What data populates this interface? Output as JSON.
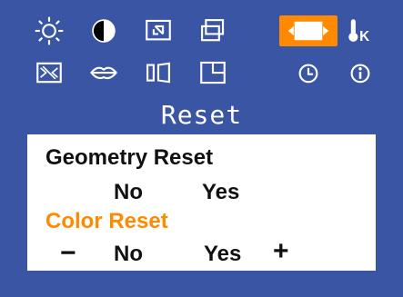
{
  "menu": {
    "title": "Reset",
    "icons": [
      {
        "name": "brightness-icon"
      },
      {
        "name": "contrast-icon"
      },
      {
        "name": "position-icon"
      },
      {
        "name": "size-icon"
      },
      {
        "name": "reset-icon",
        "selected": true
      },
      {
        "name": "color-temperature-icon",
        "label": "K"
      },
      {
        "name": "image-setup-icon"
      },
      {
        "name": "language-icon"
      },
      {
        "name": "geometry-icon"
      },
      {
        "name": "osd-position-icon"
      },
      {
        "name": "clock-icon"
      },
      {
        "name": "information-icon"
      }
    ]
  },
  "panel": {
    "geometry_reset": {
      "label": "Geometry Reset",
      "no": "No",
      "yes": "Yes"
    },
    "color_reset": {
      "label": "Color Reset",
      "minus": "−",
      "no": "No",
      "yes": "Yes",
      "plus": "+"
    }
  },
  "colors": {
    "background": "#3b55a5",
    "highlight": "#ff8a00",
    "panel": "#ffffff",
    "text": "#111111"
  }
}
